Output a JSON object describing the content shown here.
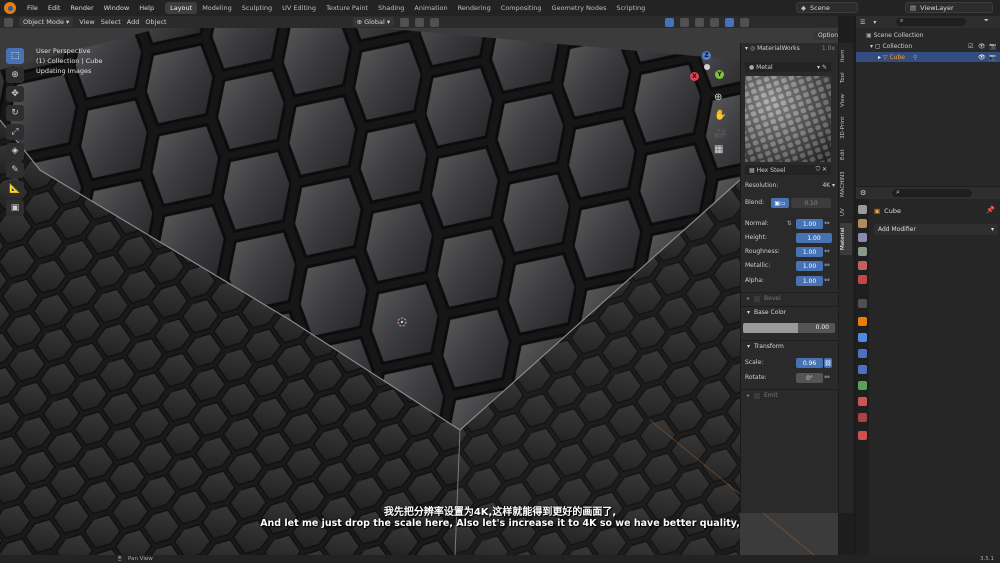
{
  "topbar": {
    "menus": [
      "File",
      "Edit",
      "Render",
      "Window",
      "Help"
    ],
    "workspaces": [
      "Layout",
      "Modeling",
      "Sculpting",
      "UV Editing",
      "Texture Paint",
      "Shading",
      "Animation",
      "Rendering",
      "Compositing",
      "Geometry Nodes",
      "Scripting"
    ],
    "active_workspace": "Layout",
    "scene": "Scene",
    "view_layer": "ViewLayer"
  },
  "viewport_header": {
    "mode": "Object Mode",
    "menus": [
      "View",
      "Select",
      "Add",
      "Object"
    ],
    "transform_orientation": "Global",
    "options": "Options"
  },
  "viewport": {
    "perspective": "User Perspective",
    "collection_object": "(1) Collection | Cube",
    "status": "Updating Images"
  },
  "gizmo": {
    "x": "X",
    "y": "Y",
    "z": "Z"
  },
  "materialworks": {
    "title": "MaterialWorks",
    "version": "1.0x",
    "material_name": "Metal",
    "preset_name": "Hex Steel",
    "resolution_label": "Resolution:",
    "resolution_value": "4K",
    "blend_label": "Blend:",
    "blend_value": "0.10",
    "params": [
      {
        "label": "Normal:",
        "value": "1.00"
      },
      {
        "label": "Height:",
        "value": "1.00"
      },
      {
        "label": "Roughness:",
        "value": "1.00"
      },
      {
        "label": "Metallic:",
        "value": "1.00"
      },
      {
        "label": "Alpha:",
        "value": "1.00"
      }
    ],
    "bevel_label": "Bevel",
    "base_color_label": "Base Color",
    "base_color_value": "0.00",
    "transform_label": "Transform",
    "scale_label": "Scale:",
    "scale_value": "0.96",
    "rotate_label": "Rotate:",
    "rotate_value": "0°",
    "emit_label": "Emit"
  },
  "ntabs": [
    "Item",
    "Tool",
    "View",
    "3D-Print",
    "Edit",
    "MACHIN3",
    "UV",
    "Material"
  ],
  "outliner": {
    "scene_collection": "Scene Collection",
    "collection": "Collection",
    "object": "Cube"
  },
  "properties": {
    "object_name": "Cube",
    "add_modifier": "Add Modifier"
  },
  "subtitles": {
    "zh": "我先把分辨率设置为4K,这样就能得到更好的画面了,",
    "en": "And let me just drop the scale here, Also let's increase it to 4K so we have better quality,"
  },
  "statusbar": {
    "pan_view": "Pan View",
    "version": "3.5.1"
  },
  "colors": {
    "accent": "#4772b3",
    "orange": "#e87d0d",
    "selected_row": "#334d80"
  }
}
